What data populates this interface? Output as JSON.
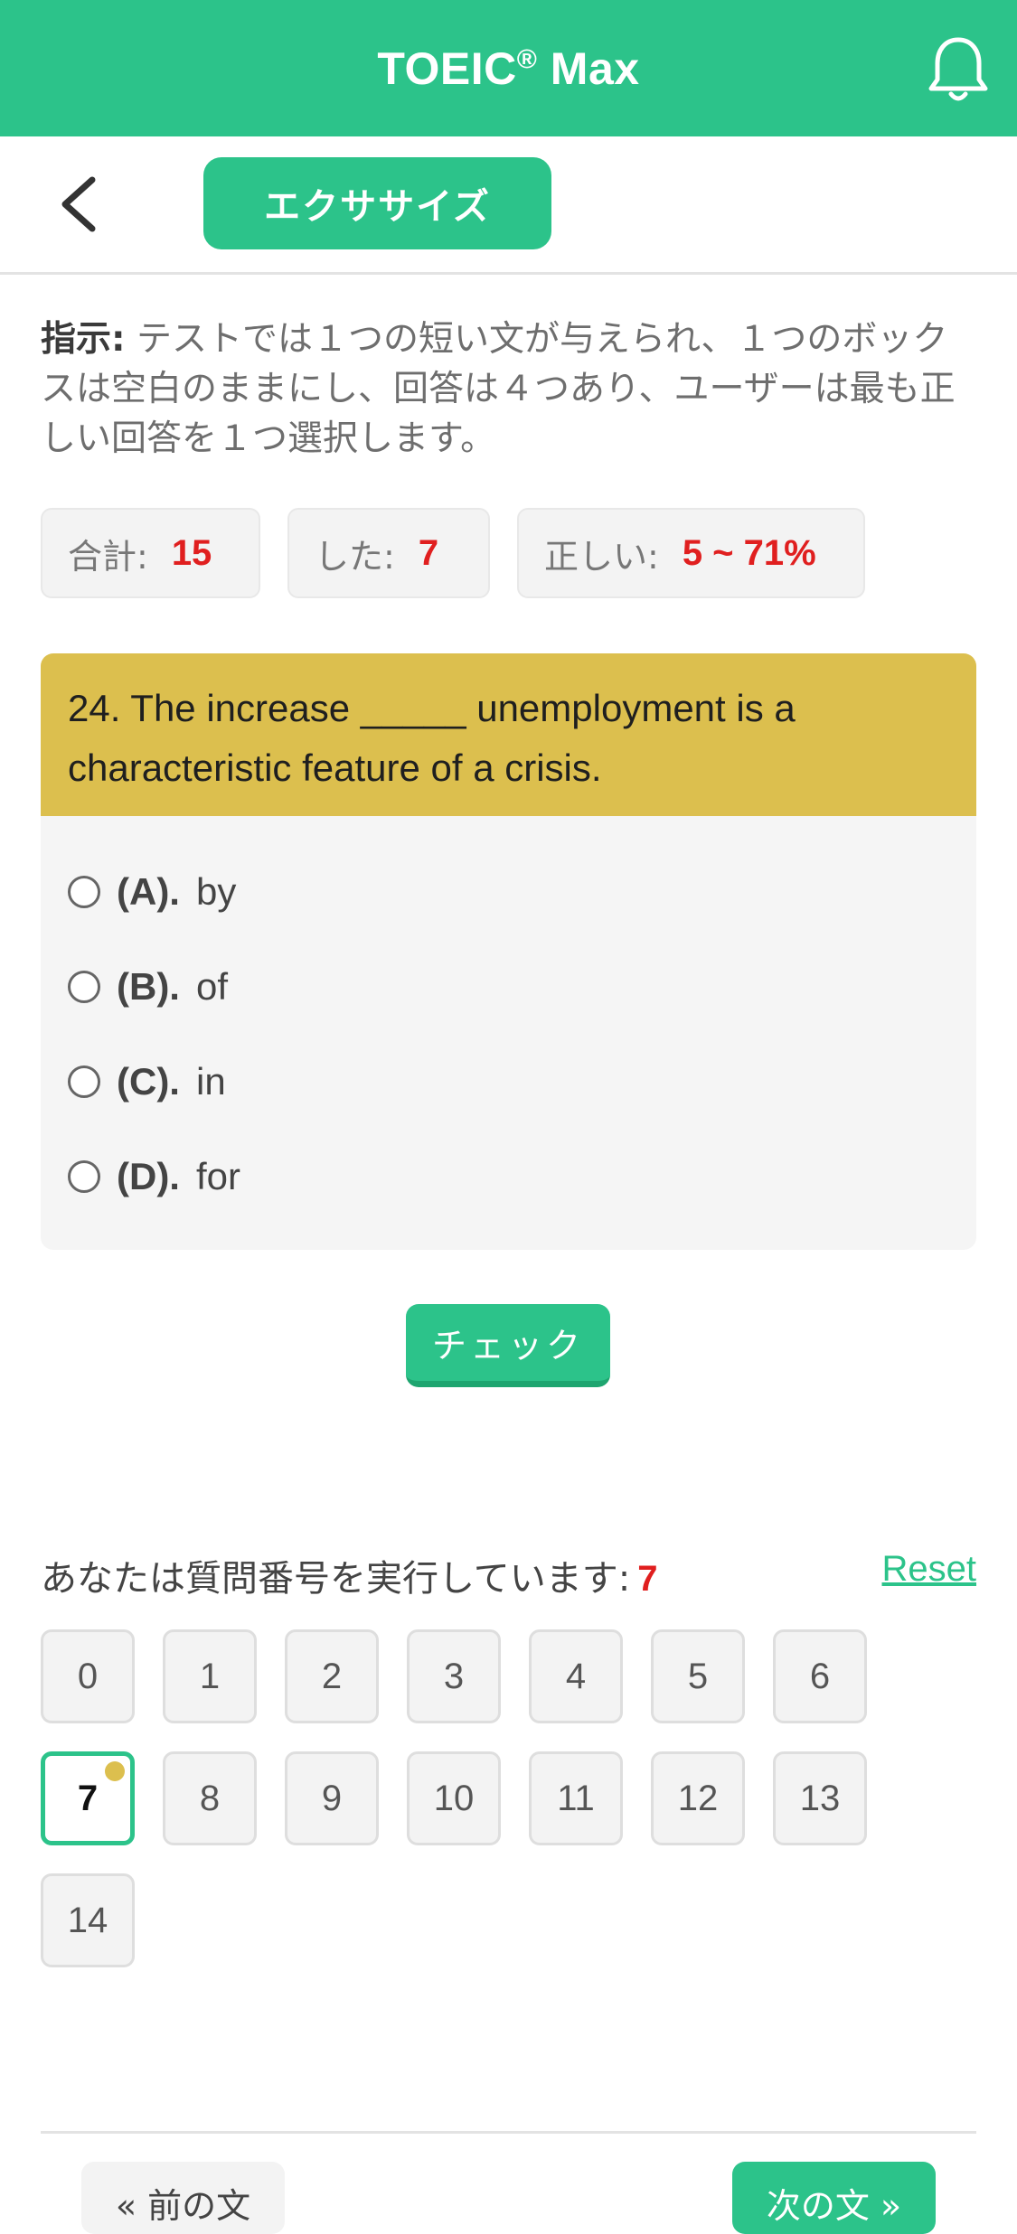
{
  "header": {
    "title": "TOEIC",
    "title_mark": "®",
    "title_suffix": " Max",
    "bell_icon": "bell-icon",
    "brand_color": "#2cc38a"
  },
  "subbar": {
    "back_icon": "chevron-left-icon",
    "tab_label": "エクササイズ"
  },
  "instructions": {
    "label": "指示:",
    "text": " テストでは１つの短い文が与えられ、１つのボックスは空白のままにし、回答は４つあり、ユーザーは最も正しい回答を１つ選択します。"
  },
  "stats": [
    {
      "label": "合計:",
      "value": "15"
    },
    {
      "label": "した:",
      "value": "7"
    },
    {
      "label": "正しい:",
      "value": "5 ~ 71%"
    }
  ],
  "question": {
    "text": "24. The increase _____ unemployment is a characteristic feature of a crisis.",
    "header_color": "#dcbf4e",
    "options": [
      {
        "letter": "(A).",
        "text": "by"
      },
      {
        "letter": "(B).",
        "text": "of"
      },
      {
        "letter": "(C).",
        "text": "in"
      },
      {
        "letter": "(D).",
        "text": "for"
      }
    ]
  },
  "check_button": "チェック",
  "progress": {
    "label": "あなたは質問番号を実行しています:",
    "current": "7",
    "reset": "Reset"
  },
  "question_numbers": [
    "0",
    "1",
    "2",
    "3",
    "4",
    "5",
    "6",
    "7",
    "8",
    "9",
    "10",
    "11",
    "12",
    "13",
    "14"
  ],
  "nav": {
    "prev": "« 前の文",
    "next": "次の文 »"
  }
}
